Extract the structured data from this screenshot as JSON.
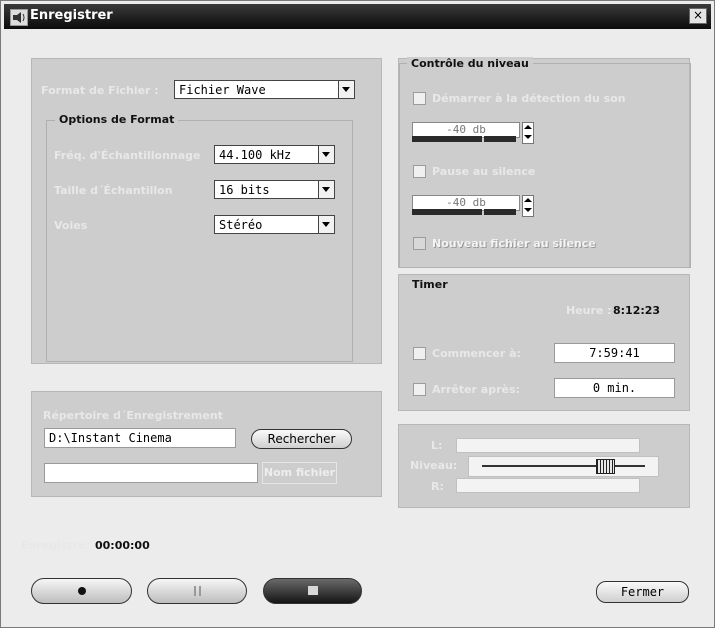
{
  "window": {
    "title": "Enregistrer",
    "close_glyph": "×"
  },
  "format": {
    "label": "Format de Fichier :",
    "value": "Fichier Wave",
    "options_title": "Options de Format",
    "freq_label": "Fréq. d'Échantillonnage",
    "freq_value": "44.100 kHz",
    "size_label": "Taille d´Échantillon",
    "size_value": "16 bits",
    "channels_label": "Voies",
    "channels_value": "Stéréo"
  },
  "directory": {
    "label": "Répertoire d´Enregistrement",
    "path": "D:\\Instant Cinema",
    "browse_button": "Rechercher",
    "filename_button": "Nom fichier",
    "filename_value": ""
  },
  "level_control": {
    "title": "Contrôle du niveau",
    "sound_detect_label": "Démarrer à la détection du son",
    "sound_detect_checked": false,
    "sound_detect_value": "-40 db",
    "pause_label": "Pause au silence",
    "pause_checked": false,
    "pause_value": "-40 db",
    "new_file_label": "Nouveau fichier au silence",
    "new_file_checked": false
  },
  "timer": {
    "title": "Timer",
    "time_label": "Heure :",
    "time_value": "8:12:23",
    "start_label": "Commencer à:",
    "start_value": "7:59:41",
    "start_checked": false,
    "stop_label": "Arrêter après:",
    "stop_value": "0 min.",
    "stop_checked": false
  },
  "levels": {
    "left_label": "L:",
    "level_label": "Niveau:",
    "right_label": "R:",
    "level_slider": 0.78
  },
  "recorded": {
    "label": "Enregistré:",
    "value": "00:00:00"
  },
  "buttons": {
    "close": "Fermer",
    "record_icon": "record-icon",
    "pause_icon": "pause-icon",
    "stop_icon": "stop-icon"
  }
}
